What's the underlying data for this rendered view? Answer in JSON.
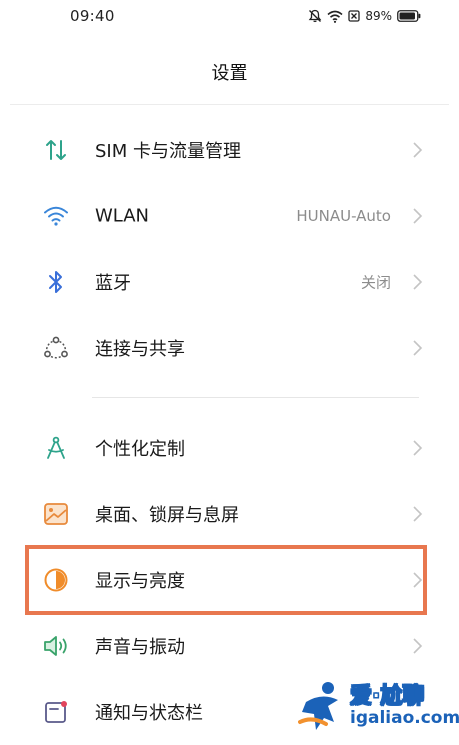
{
  "status_bar": {
    "time": "09:40",
    "battery": "89%",
    "icons": [
      "mute-icon",
      "wifi-icon",
      "sim-status-icon",
      "battery-icon"
    ]
  },
  "header": {
    "title": "设置"
  },
  "settings": {
    "items": [
      {
        "label": "SIM 卡与流量管理",
        "value": "",
        "icon": "sim-traffic-icon",
        "color": "#2ea38b"
      },
      {
        "label": "WLAN",
        "value": "HUNAU-Auto",
        "icon": "wifi-icon",
        "color": "#3a86d9"
      },
      {
        "label": "蓝牙",
        "value": "关闭",
        "icon": "bluetooth-icon",
        "color": "#3a6fd9"
      },
      {
        "label": "连接与共享",
        "value": "",
        "icon": "connection-share-icon",
        "color": "#555555"
      },
      {
        "label": "个性化定制",
        "value": "",
        "icon": "compass-icon",
        "color": "#2ea38b"
      },
      {
        "label": "桌面、锁屏与息屏",
        "value": "",
        "icon": "wallpaper-icon",
        "color": "#e88a3c"
      },
      {
        "label": "显示与亮度",
        "value": "",
        "icon": "brightness-icon",
        "color": "#f08c2a"
      },
      {
        "label": "声音与振动",
        "value": "",
        "icon": "speaker-icon",
        "color": "#39a36a"
      },
      {
        "label": "通知与状态栏",
        "value": "",
        "icon": "notification-icon",
        "color": "#5a5a8a"
      }
    ]
  },
  "highlight": {
    "target": "显示与亮度",
    "color": "#e8774f"
  },
  "watermark": {
    "title": "爱·尬聊",
    "url": "igaliao.com"
  }
}
